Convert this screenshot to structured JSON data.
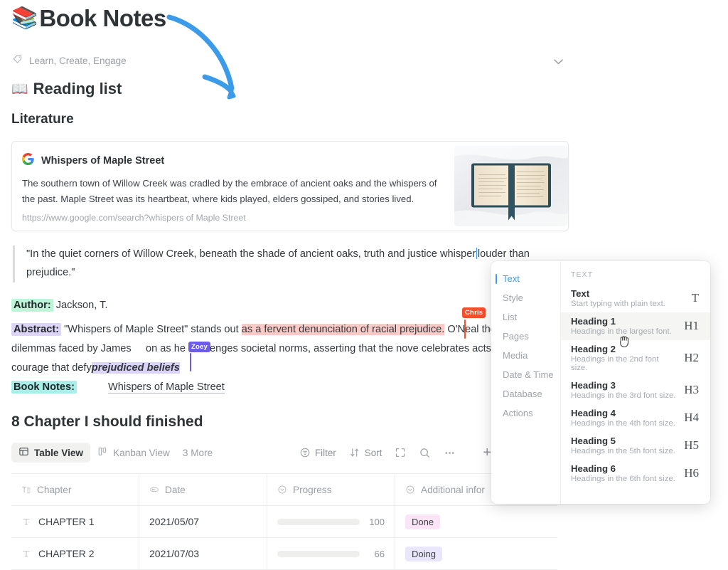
{
  "header": {
    "emoji": "books-emoji",
    "title": "Book Notes",
    "tagline": "Learn, Create, Engage",
    "tag_icon": "tag-icon",
    "collapse_icon": "chevron-down-icon"
  },
  "annotation": {
    "arrow_color": "#3b9be8",
    "name": "blue-arrow-annotation"
  },
  "sections": {
    "h1": "Reading list",
    "h1_emoji": "open-book-emoji",
    "h2": "Literature"
  },
  "bookmark": {
    "favicon": "google-g-icon",
    "title": "Whispers of Maple Street",
    "description": "The southern town of Willow Creek was cradled by the embrace of ancient oaks and the whispers of the past. Maple Street was its heartbeat, where kids played, elders gossiped, and stories lived.",
    "url": "https://www.google.com/search?whispers of Maple Street",
    "thumbnail_alt": "open-book-photo"
  },
  "quote": {
    "before_caret": "\"In the quiet corners of Willow Creek, beneath the shade of ancient oaks, truth and justice whisper",
    "after_caret": "louder than prejudice.\""
  },
  "meta": {
    "author_label": "Author:",
    "author_value": "Jackson, T.",
    "abstract_label": "Abstract:",
    "abstract_part1": "\"Whispers of Maple Street\" stands out ",
    "abstract_highlight_red": "as a fervent denunciation of racial prejudice.",
    "abstract_part2": " O'Neal",
    "abstract_part3": "the moral dilemmas faced by James",
    "abstract_part4": "on as he challenges societal norms, asserting that the nove",
    "abstract_part5": "celebrates acts of courage that defy",
    "abstract_highlight_lavender": "prejudiced beliefs",
    "booknotes_label": "Book Notes:",
    "booknotes_link": "Whispers of Maple Street"
  },
  "collab_markers": [
    {
      "name": "Chris",
      "color": "#f4502b"
    },
    {
      "name": "Zoey",
      "color": "#6c5ce7"
    }
  ],
  "database": {
    "title": "8 Chapter I should finished",
    "views": [
      {
        "label": "Table View",
        "icon": "table-icon",
        "active": true
      },
      {
        "label": "Kanban View",
        "icon": "kanban-icon",
        "active": false
      }
    ],
    "more_views": "3 More",
    "toolbar": [
      {
        "label": "Filter",
        "icon": "filter-icon"
      },
      {
        "label": "Sort",
        "icon": "sort-icon"
      },
      {
        "label": "",
        "icon": "expand-icon"
      },
      {
        "label": "",
        "icon": "search-icon"
      },
      {
        "label": "",
        "icon": "more-dots-icon"
      }
    ],
    "add_label": "+",
    "columns": [
      {
        "label": "Chapter",
        "icon": "text-type-icon"
      },
      {
        "label": "Date",
        "icon": "date-type-icon"
      },
      {
        "label": "Progress",
        "icon": "select-type-icon"
      },
      {
        "label": "Additional infor",
        "icon": "select-type-icon"
      }
    ],
    "rows": [
      {
        "chapter": "CHAPTER 1",
        "chapter_icon": "text-cell-icon",
        "date": "2021/05/07",
        "progress_value": 100,
        "progress_color": "#16c784",
        "status": "Done",
        "status_bg": "#fbe4f5",
        "status_color": "#3a3f44"
      },
      {
        "chapter": "CHAPTER 2",
        "chapter_icon": "text-cell-icon",
        "date": "2021/07/03",
        "progress_value": 66,
        "progress_color": "#2476f2",
        "status": "Doing",
        "status_bg": "#eae6fb",
        "status_color": "#3a3f44"
      }
    ]
  },
  "command_menu": {
    "categories": [
      {
        "label": "Text",
        "active": true
      },
      {
        "label": "Style",
        "active": false
      },
      {
        "label": "List",
        "active": false
      },
      {
        "label": "Pages",
        "active": false
      },
      {
        "label": "Media",
        "active": false
      },
      {
        "label": "Date & Time",
        "active": false
      },
      {
        "label": "Database",
        "active": false
      },
      {
        "label": "Actions",
        "active": false
      }
    ],
    "section_label": "TEXT",
    "items": [
      {
        "name": "Text",
        "desc": "Start typing with plain text.",
        "badge": "T",
        "hover": false
      },
      {
        "name": "Heading 1",
        "desc": "Headings in the largest font.",
        "badge": "H1",
        "hover": true
      },
      {
        "name": "Heading 2",
        "desc": "Headings in the 2nd font size.",
        "badge": "H2",
        "hover": false
      },
      {
        "name": "Heading 3",
        "desc": "Headings in the 3rd font size.",
        "badge": "H3",
        "hover": false
      },
      {
        "name": "Heading 4",
        "desc": "Headings in the 4th font size.",
        "badge": "H4",
        "hover": false
      },
      {
        "name": "Heading 5",
        "desc": "Headings in the 5th font size.",
        "badge": "H5",
        "hover": false
      },
      {
        "name": "Heading 6",
        "desc": "Headings in the 6th font size.",
        "badge": "H6",
        "hover": false
      }
    ],
    "cursor": "grab-hand-cursor"
  }
}
